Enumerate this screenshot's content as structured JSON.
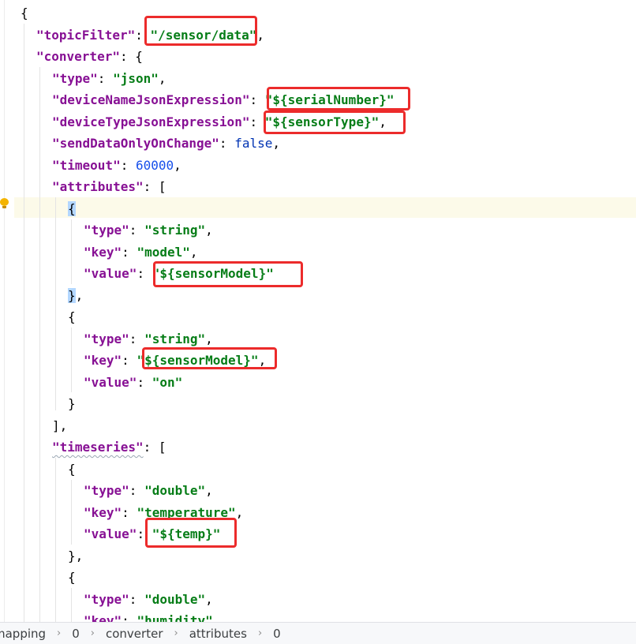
{
  "code": {
    "l0_open": "{",
    "topicFilter_key": "\"topicFilter\"",
    "topicFilter_val": "\"/sensor/data\"",
    "converter_key": "\"converter\"",
    "type_key": "\"type\"",
    "type_val": "\"json\"",
    "deviceName_key": "\"deviceNameJsonExpression\"",
    "deviceName_val": "\"${serialNumber}\"",
    "deviceType_key": "\"deviceTypeJsonExpression\"",
    "deviceType_val": "\"${sensorType}\"",
    "sendData_key": "\"sendDataOnlyOnChange\"",
    "sendData_val": "false",
    "timeout_key": "\"timeout\"",
    "timeout_val": "60000",
    "attributes_key": "\"attributes\"",
    "attr1_type_key": "\"type\"",
    "attr1_type_val": "\"string\"",
    "attr1_key_key": "\"key\"",
    "attr1_key_val": "\"model\"",
    "attr1_value_key": "\"value\"",
    "attr1_value_val": "\"${sensorModel}\"",
    "attr2_type_key": "\"type\"",
    "attr2_type_val": "\"string\"",
    "attr2_key_key": "\"key\"",
    "attr2_key_val": "\"${sensorModel}\"",
    "attr2_value_key": "\"value\"",
    "attr2_value_val": "\"on\"",
    "timeseries_key": "\"timeseries\"",
    "ts1_type_key": "\"type\"",
    "ts1_type_val": "\"double\"",
    "ts1_key_key": "\"key\"",
    "ts1_key_val": "\"temperature\"",
    "ts1_value_key": "\"value\"",
    "ts1_value_val": "\"${temp}\"",
    "ts2_type_key": "\"type\"",
    "ts2_type_val": "\"double\"",
    "ts2_key_key": "\"key\"",
    "ts2_key_val": "\"humidity\""
  },
  "punct": {
    "colon": ": ",
    "comma": ",",
    "open_brace": "{",
    "close_brace": "}",
    "open_bracket": "[",
    "close_bracket_comma": "],",
    "close_brace_comma": "},",
    "colon_open_brace": ": {",
    "colon_open_bracket": ": ["
  },
  "breadcrumb": [
    "mapping",
    "0",
    "converter",
    "attributes",
    "0"
  ],
  "colors": {
    "key": "#871094",
    "string": "#067d17",
    "number": "#1750eb",
    "keyword": "#0033b3",
    "annotation_box": "#ec2b2b",
    "caret_line": "#fcfae9"
  },
  "icons": [
    "intention-bulb-icon",
    "breadcrumb-chevron-icon"
  ]
}
